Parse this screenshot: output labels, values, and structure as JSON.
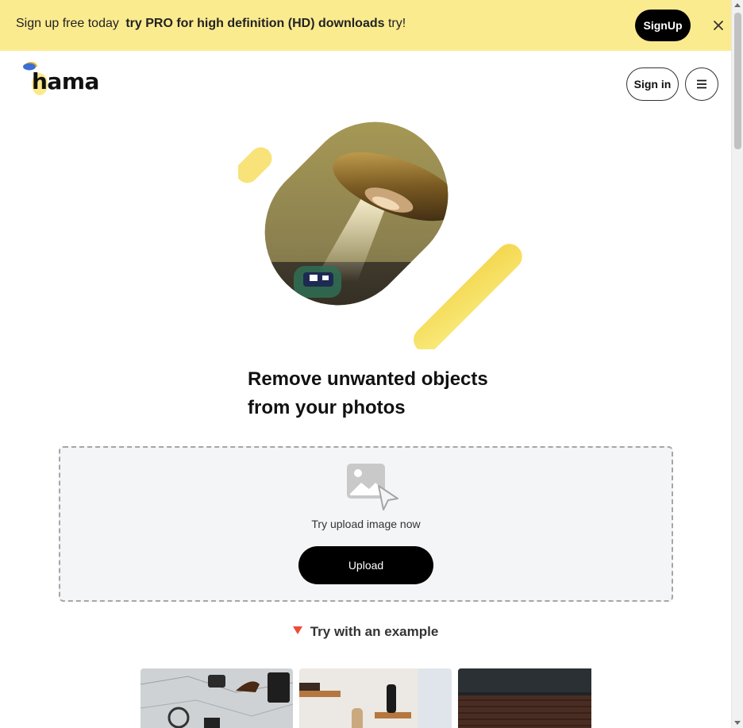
{
  "banner": {
    "text": "Sign up free today",
    "bold_text": "try PRO for high definition (HD) downloads",
    "suffix": "try!",
    "signup_label": "SignUp",
    "close_icon": "close-icon",
    "background": "#fbeb8f"
  },
  "header": {
    "logo_text": "hama",
    "signin_label": "Sign in",
    "menu_icon": "hamburger-menu-icon"
  },
  "hero": {
    "illustration": "ufo-abducting-cow-illustration",
    "accent_color": "#f5e063"
  },
  "headline": {
    "prefix": "Remove ",
    "highlight": "unwanted objects",
    "line2": "from your photos"
  },
  "upload": {
    "icon": "upload-image-icon",
    "caption": "Try upload image now",
    "button_label": "Upload"
  },
  "examples": {
    "heading": "Try with an example",
    "items": [
      {
        "name": "example-desk-map"
      },
      {
        "name": "example-wall-shelves"
      },
      {
        "name": "example-dark-interior"
      }
    ]
  }
}
